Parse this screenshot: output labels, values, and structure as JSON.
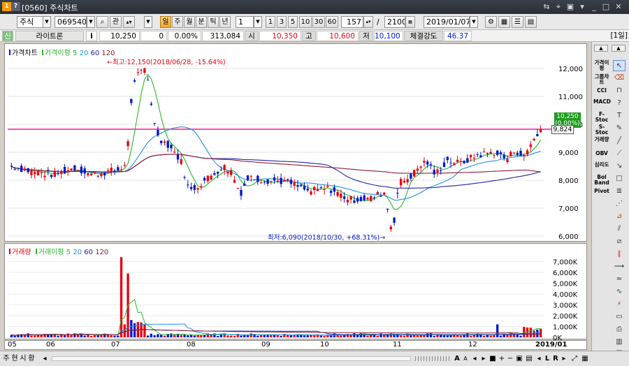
{
  "window": {
    "title": "[0560] 주식차트"
  },
  "toolbar": {
    "market": "주식",
    "code": "069540",
    "search_icon": "search-icon",
    "kwan": "관",
    "periods": [
      "일",
      "주",
      "월",
      "분",
      "틱",
      "년"
    ],
    "interval": "1",
    "presets": [
      "1",
      "3",
      "5",
      "10",
      "30",
      "60"
    ],
    "count": "157",
    "slash": "/",
    "total": "2100",
    "date": "2019/01/07"
  },
  "info": {
    "sin": "신",
    "name": "라이트론",
    "i": "i",
    "price": "10,250",
    "change": "0",
    "change_pct": "0.00%",
    "volume": "313,084",
    "open_label": "시",
    "open": "10,350",
    "high_label": "고",
    "high": "10,600",
    "low_label": "저",
    "low": "10,100",
    "strength_label": "체결강도",
    "strength": "46.37",
    "period_badge": "[1일]"
  },
  "price_panel": {
    "legend_main": "가격차트",
    "legend_ma": "가격이평",
    "ma_periods": [
      "5",
      "20",
      "60",
      "120"
    ],
    "high_note": "←최고:12,150(2018/06/28, -15.64%)",
    "low_note": "최저:6,090(2018/10/30, +68.31%)→",
    "current_price": "10,250",
    "current_pct": "(0.00%)",
    "line_value": "9,824",
    "y_ticks": [
      "12,000",
      "11,000",
      "10,000",
      "9,000",
      "8,000",
      "7,000",
      "6,000"
    ]
  },
  "volume_panel": {
    "legend_main": "거래량",
    "legend_ma": "거래이평",
    "ma_periods": [
      "5",
      "20",
      "60",
      "120"
    ],
    "y_ticks": [
      "7,000K",
      "6,000K",
      "5,000K",
      "4,000K",
      "3,000K",
      "2,000K",
      "1,000K",
      "0K"
    ]
  },
  "x_ticks": [
    "05",
    "06",
    "07",
    "08",
    "09",
    "10",
    "11",
    "12",
    "2019/01"
  ],
  "right_tools": {
    "indicators": [
      "가격이평",
      "그룹차트",
      "CCI",
      "MACD",
      "F-Stoc",
      "S-Stoc",
      "거래량",
      "OBV",
      "심리도",
      "Bol Band",
      "Pivot"
    ]
  },
  "bottom": {
    "tabs": [
      "주",
      "현",
      "시",
      "황"
    ],
    "nav": [
      "A",
      "A",
      "+",
      "−",
      "L",
      "R"
    ]
  },
  "colors": {
    "up": "#e8000f",
    "down": "#0018c8",
    "ma5": "#2db52d",
    "ma20": "#1e90e0",
    "ma60": "#2323a0",
    "ma120": "#8b1a3a",
    "hline": "#ff1493"
  }
}
